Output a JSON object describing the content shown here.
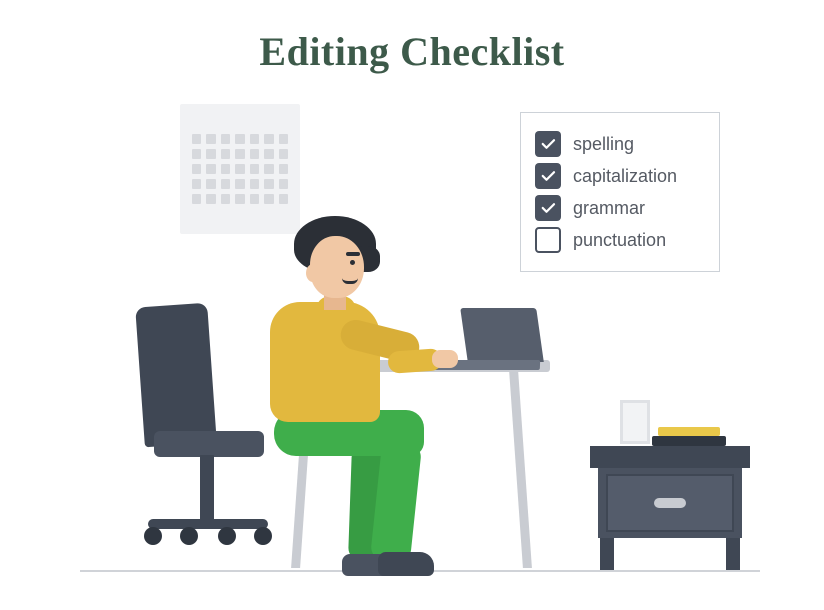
{
  "title": "Editing Checklist",
  "checklist": {
    "items": [
      {
        "label": "spelling",
        "checked": true
      },
      {
        "label": "capitalization",
        "checked": true
      },
      {
        "label": "grammar",
        "checked": true
      },
      {
        "label": "punctuation",
        "checked": false
      }
    ]
  },
  "colors": {
    "title": "#3d5a4a",
    "checkbox_fill": "#4a5260",
    "shirt": "#e2b83e",
    "pants": "#3fae4b"
  }
}
